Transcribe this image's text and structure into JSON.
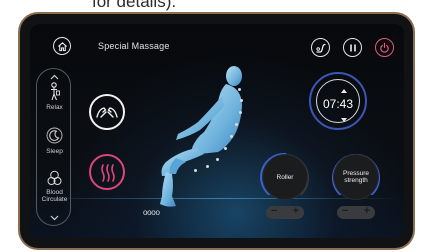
{
  "caption_fragment": "for details).",
  "header": {
    "title": "Special  Massage",
    "home_icon": "home-icon",
    "shoulder_icon": "shoulder-adjust-icon",
    "pause_icon": "pause-icon",
    "power_icon": "power-icon"
  },
  "sidebar": {
    "items": [
      {
        "label": "Relax",
        "icon": "relax-person-icon"
      },
      {
        "label": "Sleep",
        "icon": "moon-icon"
      },
      {
        "label": "Blood\nCirculate",
        "icon": "circulation-icon"
      }
    ]
  },
  "left_controls": {
    "hands_icon": "massage-hands-icon",
    "heat_icon": "heat-waves-icon"
  },
  "timer": {
    "value": "07:43"
  },
  "knobs": [
    {
      "label": "Roller",
      "minus": "−",
      "plus": "+"
    },
    {
      "label": "Pressure\nstrength",
      "minus": "−",
      "plus": "+"
    }
  ],
  "foot_dots": "oooo",
  "colors": {
    "accent_blue": "#3a63d6",
    "power_pink": "#e8577a",
    "heat_pink": "#e0457c"
  }
}
